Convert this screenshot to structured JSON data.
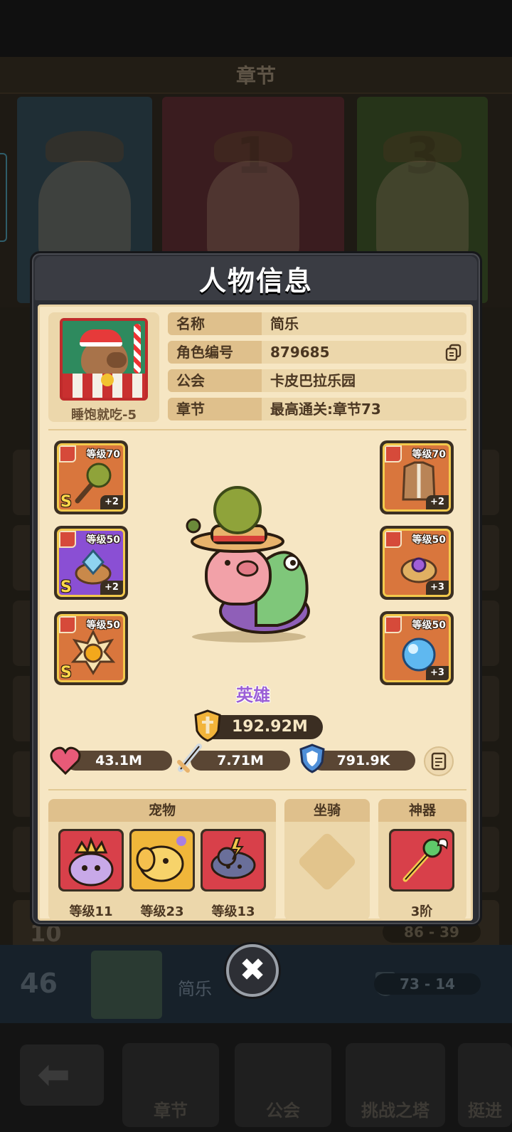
{
  "background": {
    "title": "章节",
    "card_numbers": [
      "1",
      "3"
    ],
    "list_rank": "10",
    "list_score": "86 - 39",
    "self_rank": "46",
    "self_name": "简乐",
    "self_score": "73 - 14",
    "nav": [
      "章节",
      "公会",
      "挑战之塔",
      "挺进"
    ]
  },
  "modal": {
    "title": "人物信息",
    "avatar_label": "睡饱就吃-5",
    "info": [
      {
        "key": "名称",
        "value": "简乐"
      },
      {
        "key": "角色编号",
        "value": "879685"
      },
      {
        "key": "公会",
        "value": "卡皮巴拉乐园"
      },
      {
        "key": "章节",
        "value": "最高通关:章节73"
      }
    ],
    "equipment_left": [
      {
        "slot": "weapon",
        "level": "等级70",
        "tier": "S",
        "plus": "+2",
        "rarity": "orange"
      },
      {
        "slot": "ring",
        "level": "等级50",
        "tier": "S",
        "plus": "+2",
        "rarity": "purple"
      },
      {
        "slot": "necklace",
        "level": "等级50",
        "tier": "S",
        "plus": "",
        "rarity": "orange"
      }
    ],
    "equipment_right": [
      {
        "slot": "armor",
        "level": "等级70",
        "plus": "+2",
        "rarity": "orange"
      },
      {
        "slot": "bracer",
        "level": "等级50",
        "plus": "+3",
        "rarity": "orange"
      },
      {
        "slot": "orb",
        "level": "等级50",
        "plus": "+3",
        "rarity": "orange"
      }
    ],
    "hero_name": "英雄",
    "power": "192.92M",
    "stats": {
      "hp": "43.1M",
      "atk": "7.71M",
      "def": "791.9K"
    },
    "sections": {
      "pets": "宠物",
      "mount": "坐骑",
      "artifact": "神器"
    },
    "pets": [
      {
        "level": "等级11",
        "color": "#d8404a"
      },
      {
        "level": "等级23",
        "color": "#f0b63a"
      },
      {
        "level": "等级13",
        "color": "#d8404a"
      }
    ],
    "artifact_level": "3阶"
  },
  "colors": {
    "accent": "#9b5fd6",
    "parchment": "#f6e6c3",
    "frame": "#2b2d33",
    "gold": "#f2c94c"
  }
}
